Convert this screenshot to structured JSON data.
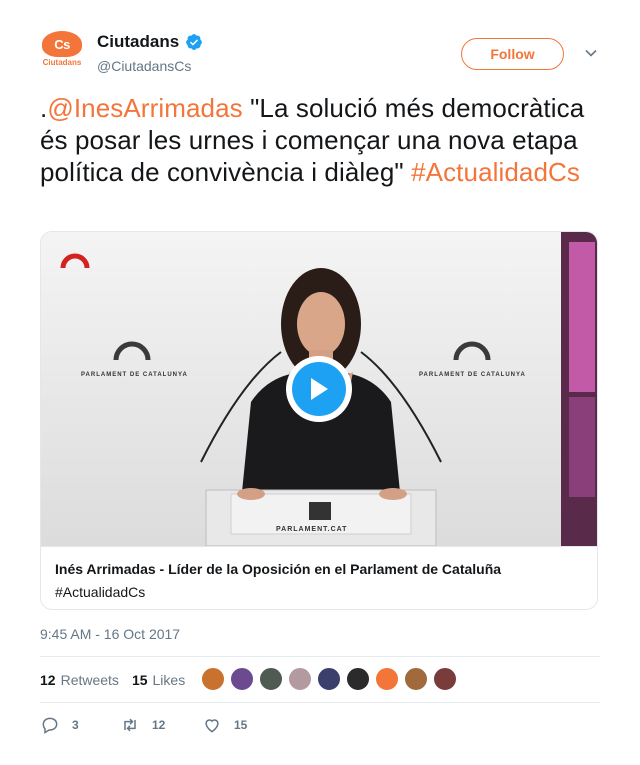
{
  "account": {
    "display_name": "Ciutadans",
    "handle": "@CiutadansCs",
    "avatar_mark": "Cs",
    "avatar_text": "Ciutadans",
    "verified": true,
    "follow_label": "Follow"
  },
  "tweet": {
    "prefix": ".",
    "mention": "@InesArrimadas",
    "body": " \"La solució més democràtica és posar les urnes i començar una nova etapa política de convivència i diàleg\" ",
    "hashtag": "#ActualidadCs"
  },
  "card": {
    "title": "Inés Arrimadas - Líder de la Oposición en el Parlament de Cataluña",
    "description": "#ActualidadCs",
    "video_sign_left": "PARLAMENT DE CATALUNYA",
    "video_sign_right": "PARLAMENT DE CATALUNYA",
    "podium_text": "PARLAMENT.CAT"
  },
  "timestamp": "9:45 AM - 16 Oct 2017",
  "stats": {
    "retweets_count": "12",
    "retweets_label": "Retweets",
    "likes_count": "15",
    "likes_label": "Likes"
  },
  "liker_colors": [
    "#c9712f",
    "#6b4a8f",
    "#4f5a52",
    "#b39aa0",
    "#3b3f6b",
    "#2b2b2b",
    "#f4753a",
    "#a06a3c",
    "#7a3b3b"
  ],
  "actions": {
    "reply_count": "3",
    "retweet_count": "12",
    "like_count": "15"
  },
  "colors": {
    "accent": "#f4753a",
    "link": "#f4753a",
    "verified": "#1da1f2",
    "play": "#1da1f2",
    "muted": "#657786"
  },
  "icons": [
    "verified-badge-icon",
    "chevron-down-icon",
    "play-icon",
    "reply-icon",
    "retweet-icon",
    "heart-icon"
  ]
}
